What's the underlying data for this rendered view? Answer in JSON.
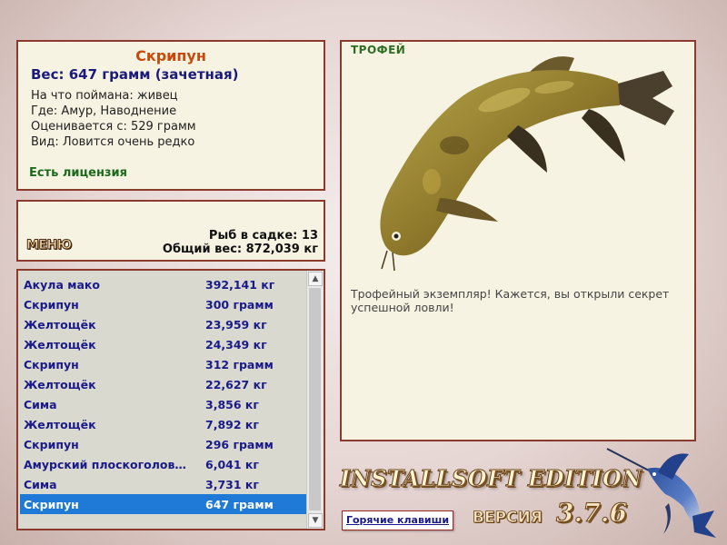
{
  "fish_info": {
    "name": "Скрипун",
    "weight": "Вес: 647 грамм (зачетная)",
    "bait": "На что поймана: живец",
    "location": "Где: Амур, Наводнение",
    "valued_from": "Оценивается с: 529 грамм",
    "rarity": "Вид: Ловится очень редко",
    "license": "Есть лицензия"
  },
  "summary": {
    "menu_label": "МЕНЮ",
    "fish_count": "Рыб в садке: 13",
    "total_weight": "Общий вес: 872,039 кг"
  },
  "catch_list": {
    "items": [
      {
        "name": "Акула мако",
        "weight": "392,141 кг"
      },
      {
        "name": "Скрипун",
        "weight": "300 грамм"
      },
      {
        "name": "Желтощёк",
        "weight": "23,959 кг"
      },
      {
        "name": "Желтощёк",
        "weight": "24,349 кг"
      },
      {
        "name": "Скрипун",
        "weight": "312 грамм"
      },
      {
        "name": "Желтощёк",
        "weight": "22,627 кг"
      },
      {
        "name": "Сима",
        "weight": "3,856 кг"
      },
      {
        "name": "Желтощёк",
        "weight": "7,892 кг"
      },
      {
        "name": "Скрипун",
        "weight": "296 грамм"
      },
      {
        "name": "Амурский плоскоголов…",
        "weight": "6,041 кг"
      },
      {
        "name": "Сима",
        "weight": "3,731 кг"
      },
      {
        "name": "Скрипун",
        "weight": "647 грамм"
      }
    ],
    "selected_index": 11
  },
  "trophy": {
    "label": "ТРОФЕЙ",
    "message": "Трофейный экземпляр! Кажется, вы открыли секрет успешной ловли!",
    "fish_image": "catfish-trophy-image"
  },
  "footer": {
    "edition": "INSTALLSOFT EDITION",
    "version_label": "ВЕРСИЯ",
    "version_number": "3.7.6",
    "hotkeys_label": "Горячие клавиши",
    "logo": "marlin-logo"
  },
  "colors": {
    "panel_border": "#8b3a2e",
    "panel_bg": "#f6f3e2",
    "fish_name": "#c84a0a",
    "selection": "#1e7ad6",
    "license": "#1a6a1a"
  }
}
